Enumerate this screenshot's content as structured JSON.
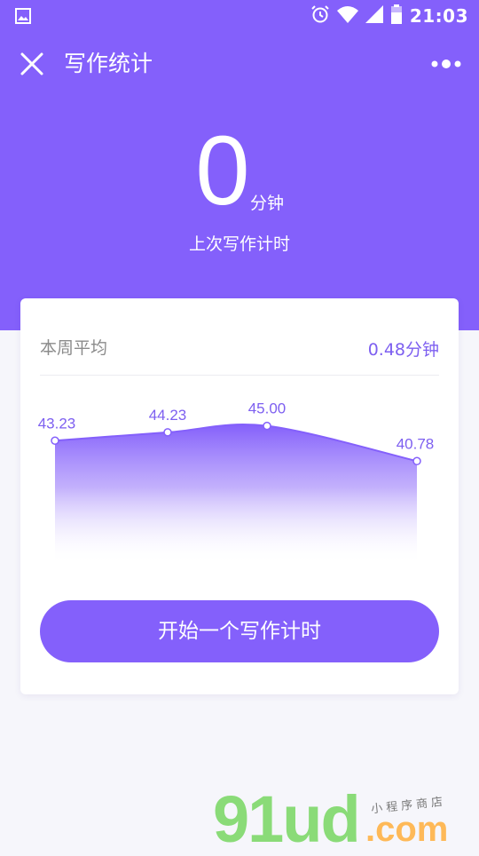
{
  "status_bar": {
    "time": "21:03",
    "icons": [
      "gallery-icon",
      "alarm-icon",
      "wifi-icon",
      "signal-icon",
      "battery-icon"
    ]
  },
  "nav": {
    "title": "写作统计",
    "close_icon": "close-icon",
    "more_icon": "more-dots-icon"
  },
  "hero": {
    "value": "0",
    "unit": "分钟",
    "caption": "上次写作计时"
  },
  "weekly": {
    "label": "本周平均",
    "value": "0.48分钟"
  },
  "chart_data": {
    "type": "area",
    "categories": [
      "",
      "",
      "",
      ""
    ],
    "values": [
      43.23,
      44.23,
      45.0,
      40.78
    ],
    "labels": [
      "43.23",
      "44.23",
      "45.00",
      "40.78"
    ],
    "title": "",
    "xlabel": "",
    "ylabel": "",
    "smooth": true,
    "grid": false
  },
  "actions": {
    "start_label": "开始一个写作计时"
  },
  "watermark": {
    "logo": "91ud",
    "domain": ".com",
    "subtitle": "小程序商店"
  },
  "colors": {
    "primary": "#8460fb",
    "accent_text": "#7d5ff0",
    "background": "#f6f6fb",
    "card": "#ffffff"
  }
}
